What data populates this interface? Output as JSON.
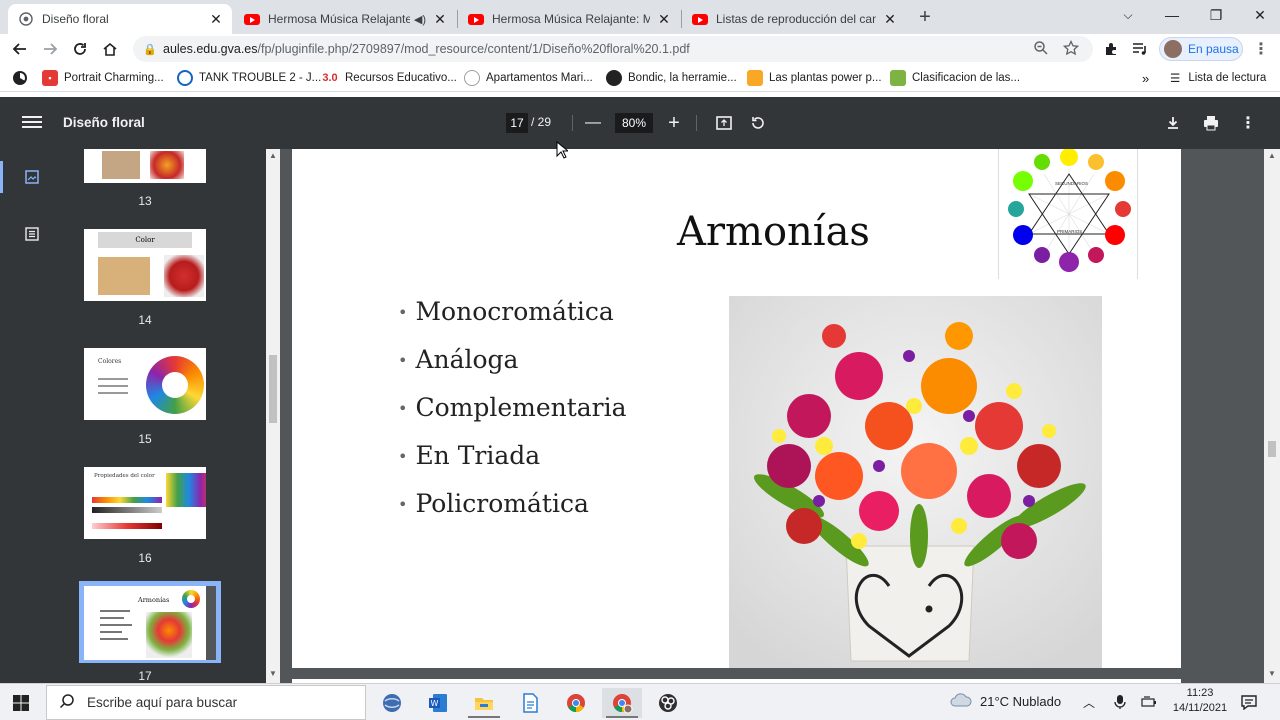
{
  "tabs": [
    {
      "title": "Diseño floral",
      "active": true
    },
    {
      "title": "Hermosa Música Relajante: M",
      "audio": true
    },
    {
      "title": "Hermosa Música Relajante: Músi"
    },
    {
      "title": "Listas de reproducción del canal"
    }
  ],
  "address": {
    "host": "aules.edu.gva.es",
    "path": "/fp/pluginfile.php/2709897/mod_resource/content/1/Diseño%20floral%20.1.pdf"
  },
  "profile_label": "En pausa",
  "bookmarks": [
    {
      "label": "Portrait Charming...",
      "color": "#e53935",
      "glyph": ""
    },
    {
      "label": "TANK TROUBLE 2 - J...",
      "color": "#1565c0",
      "glyph": ""
    },
    {
      "label": "Recursos Educativo...",
      "color": "#ffffff",
      "glyph": "3.0"
    },
    {
      "label": "Apartamentos Mari...",
      "color": "#9e9e9e",
      "glyph": ""
    },
    {
      "label": "Bondic, la herramie...",
      "color": "#222222",
      "glyph": ""
    },
    {
      "label": "Las plantas power p...",
      "color": "#f9a825",
      "glyph": ""
    },
    {
      "label": "Clasificacion de las...",
      "color": "#7cb342",
      "glyph": ""
    }
  ],
  "reading_list_label": "Lista de lectura",
  "pdf": {
    "title": "Diseño floral",
    "current_page": "17",
    "total_pages": "/ 29",
    "zoom": "80%"
  },
  "thumbnails": [
    {
      "number": "13",
      "title": ""
    },
    {
      "number": "14",
      "title": "Color"
    },
    {
      "number": "15",
      "title": "Colores"
    },
    {
      "number": "16",
      "title": "Propiedades del color"
    },
    {
      "number": "17",
      "title": "Armonías",
      "selected": true
    }
  ],
  "slide": {
    "title": "Armonías",
    "bullets": [
      "Monocromática",
      "Análoga",
      "Complementaria",
      "En Triada",
      "Policromática"
    ],
    "wheel_labels": {
      "secondary": "SECUNDARIOS",
      "primary": "PRIMARIOS"
    }
  },
  "taskbar": {
    "search_placeholder": "Escribe aquí para buscar",
    "weather": "21°C  Nublado",
    "time": "11:23",
    "date": "14/11/2021"
  },
  "colors": {
    "tab_strip": "#dee1e6",
    "pdf_toolbar": "#323639",
    "viewer_bg": "#525659",
    "accent": "#1a73e8"
  }
}
